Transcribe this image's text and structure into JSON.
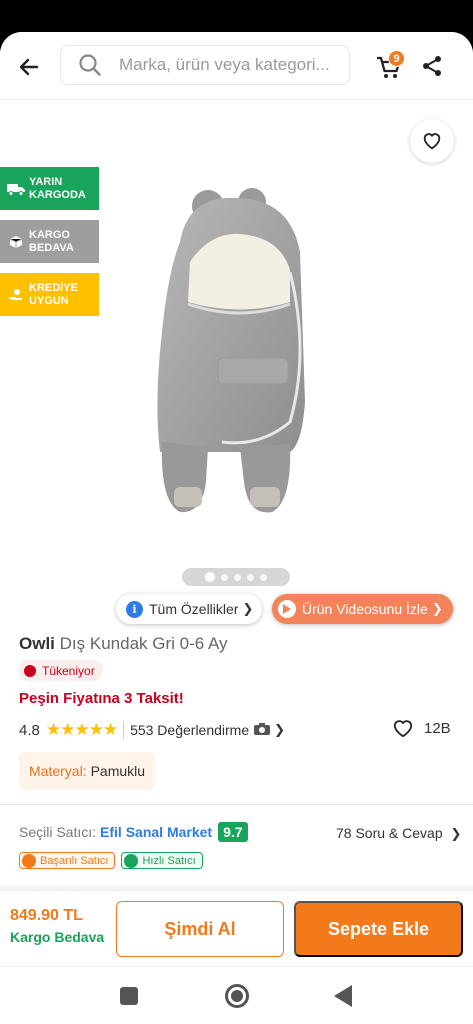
{
  "header": {
    "search_placeholder": "Marka, ürün veya kategori...",
    "cart_count": "9"
  },
  "tags": {
    "tomorrow_cargo": "YARIN KARGODA",
    "free_cargo": "KARGO BEDAVA",
    "credit": "KREDİYE UYGUN"
  },
  "gallery": {
    "image_count": 5,
    "active_index": 0
  },
  "pills": {
    "features": "Tüm Özellikler",
    "video": "Ürün Videosunu İzle"
  },
  "product": {
    "brand": "Owli",
    "name": "Dış Kundak Gri 0-6 Ay",
    "stock_status": "Tükeniyor",
    "installment": "Peşin Fiyatına 3 Taksit!",
    "rating": "4.8",
    "stars": "★★★★★",
    "reviews": "553 Değerlendirme",
    "favorites": "12B",
    "material_key": "Materyal:",
    "material_value": "Pamuklu"
  },
  "seller": {
    "label": "Seçili Satıcı:",
    "name": "Efil Sanal Market",
    "score": "9.7",
    "qa": "78 Soru & Cevap",
    "badge_success": "Başarılı Satıcı",
    "badge_fast": "Hızlı Satıcı"
  },
  "bottom": {
    "price": "849.90 TL",
    "shipping": "Kargo Bedava",
    "buy_now": "Şimdi Al",
    "add_to_cart": "Sepete Ekle"
  },
  "colors": {
    "brand_orange": "#f27a1a",
    "green": "#1aa35a",
    "red": "#c9001d"
  }
}
